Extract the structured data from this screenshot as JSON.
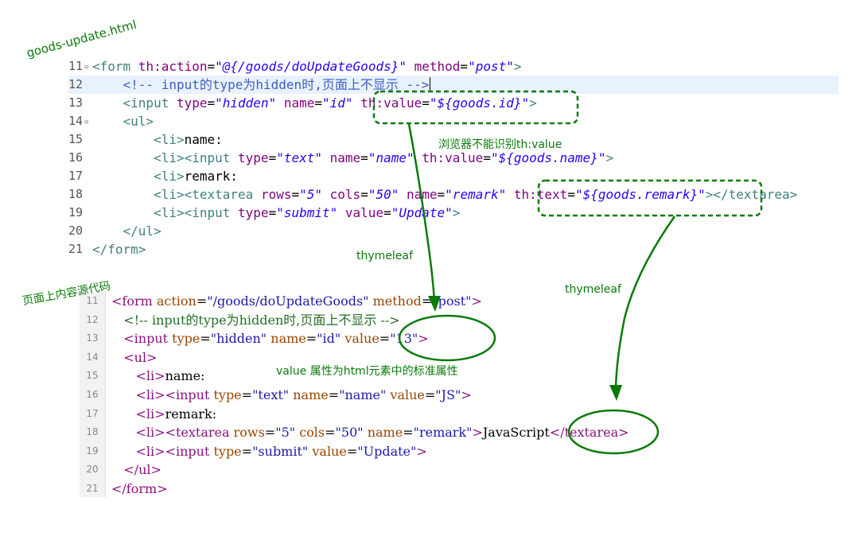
{
  "labels": {
    "file_name": "goods-update.html",
    "page_source": "页面上内容源代码",
    "browser_note": "浏览器不能识别th:value",
    "thymeleaf_left": "thymeleaf",
    "thymeleaf_right": "thymeleaf",
    "value_note": "value 属性为html元素中的标准属性"
  },
  "editor": {
    "lines": [
      {
        "num": "11",
        "fold": true
      },
      {
        "num": "12"
      },
      {
        "num": "13"
      },
      {
        "num": "14",
        "fold": true
      },
      {
        "num": "15"
      },
      {
        "num": "16"
      },
      {
        "num": "17"
      },
      {
        "num": "18"
      },
      {
        "num": "19"
      },
      {
        "num": "20"
      },
      {
        "num": "21"
      }
    ]
  },
  "source": {
    "lines": [
      "11",
      "12",
      "13",
      "14",
      "15",
      "16",
      "17",
      "18",
      "19",
      "20",
      "21"
    ]
  },
  "colors": {
    "annotation": "#0a7a0a",
    "highlight_line": "#e8f2fe"
  }
}
